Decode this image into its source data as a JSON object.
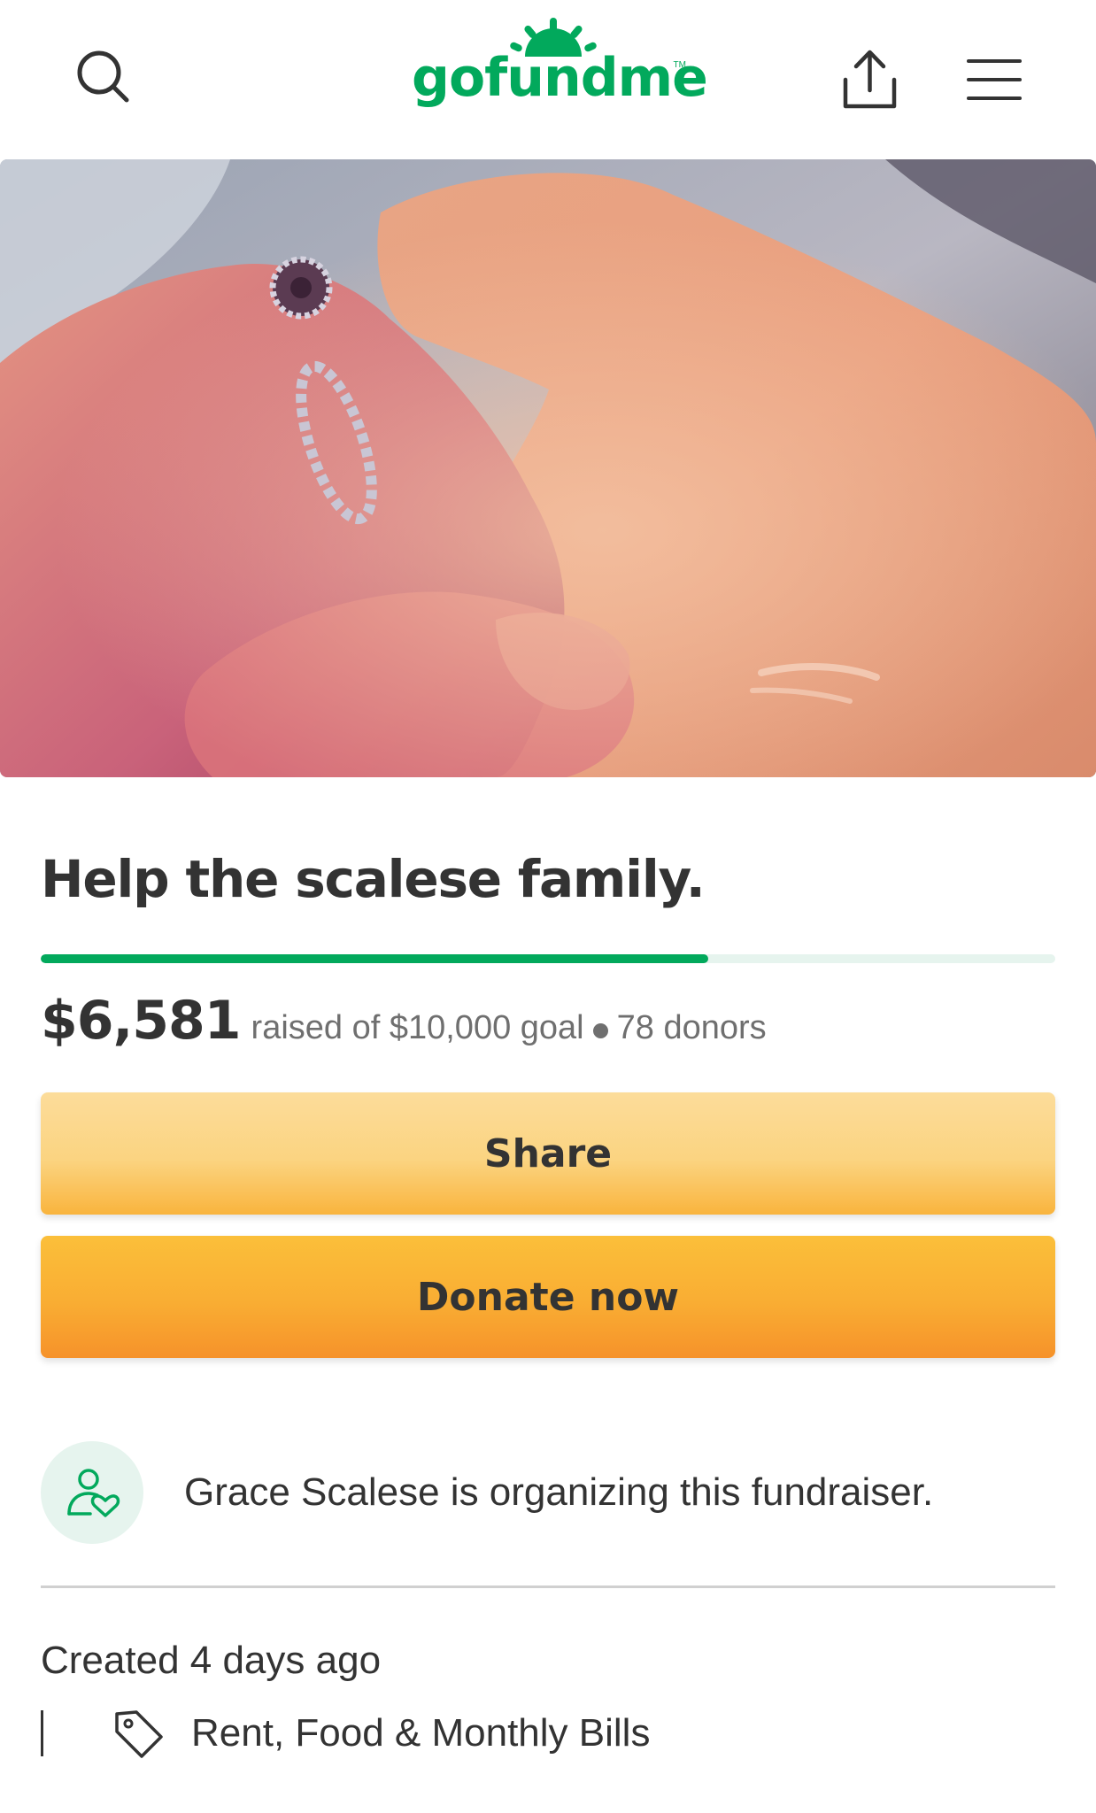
{
  "header": {
    "logo_text": "gofundme",
    "logo_tm": "TM",
    "brand_color": "#02a95c",
    "icons": [
      "search-icon",
      "share-upload-icon",
      "hamburger-menu-icon"
    ]
  },
  "campaign": {
    "title": "Help the scalese family.",
    "raised": "$6,581",
    "raised_detail": "raised of $10,000 goal",
    "donors": "78 donors",
    "progress_fraction": 0.6581
  },
  "actions": {
    "share_label": "Share",
    "donate_label": "Donate now"
  },
  "organizer": {
    "text": "Grace Scalese is organizing this fundraiser.",
    "icon": "organizer-heart-icon"
  },
  "meta": {
    "created": "Created 4 days ago",
    "category": "Rent, Food & Monthly Bills",
    "category_icon": "tag-icon"
  },
  "colors": {
    "share_button": "#fbd481",
    "donate_button": "#f9ad33",
    "progress_track": "#e6f4ee"
  }
}
